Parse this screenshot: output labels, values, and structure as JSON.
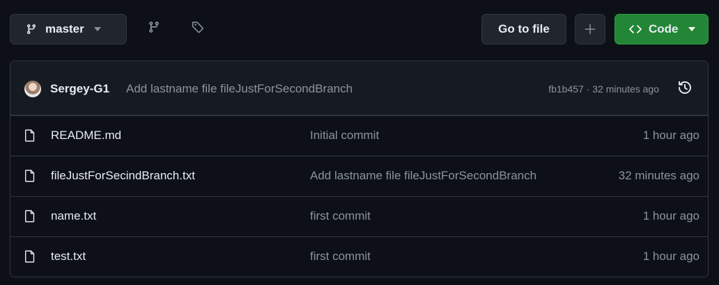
{
  "toolbar": {
    "branch_label": "master",
    "goto_file_label": "Go to file",
    "plus_label": "+",
    "code_label": "Code"
  },
  "latest_commit": {
    "author": "Sergey-G1",
    "message": "Add lastname file fileJustForSecondBranch",
    "meta": "fb1b457 · 32 minutes ago"
  },
  "files": [
    {
      "name": "README.md",
      "message": "Initial commit",
      "date": "1 hour ago"
    },
    {
      "name": "fileJustForSecindBranch.txt",
      "message": "Add lastname file fileJustForSecondBranch",
      "date": "32 minutes ago"
    },
    {
      "name": "name.txt",
      "message": "first commit",
      "date": "1 hour ago"
    },
    {
      "name": "test.txt",
      "message": "first commit",
      "date": "1 hour ago"
    }
  ],
  "icons": [
    "git-branch-icon",
    "caret-down-icon",
    "branches-icon",
    "tag-icon",
    "code-icon",
    "history-icon",
    "file-icon"
  ],
  "colors": {
    "background": "#0d1117",
    "border": "#30363d",
    "code_button": "#238636",
    "muted_text": "#8b949e"
  }
}
